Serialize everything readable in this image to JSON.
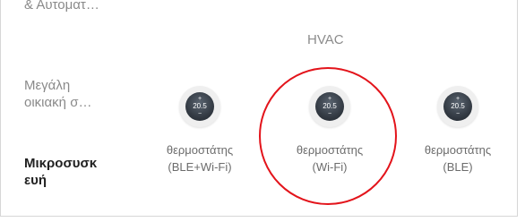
{
  "sidebar": {
    "items": [
      {
        "label_line1": "& Αυτοματ…"
      },
      {
        "label_line1": "Μεγάλη",
        "label_line2": "οικιακή σ…"
      },
      {
        "label_line1": "Μικροσυσκ",
        "label_line2": "ευή"
      }
    ]
  },
  "section": {
    "title": "HVAC"
  },
  "devices": [
    {
      "display": "20.5",
      "plus": "+",
      "minus": "−",
      "label_line1": "θερμοστάτης",
      "label_line2": "(BLE+Wi-Fi)"
    },
    {
      "display": "20.5",
      "plus": "+",
      "minus": "−",
      "label_line1": "θερμοστάτης",
      "label_line2": "(Wi-Fi)"
    },
    {
      "display": "20.5",
      "plus": "+",
      "minus": "−",
      "label_line1": "θερμοστάτης",
      "label_line2": "(BLE)"
    }
  ],
  "colors": {
    "highlight": "#e3141b",
    "active_text": "#222222",
    "inactive_text": "#8a8a8a"
  }
}
